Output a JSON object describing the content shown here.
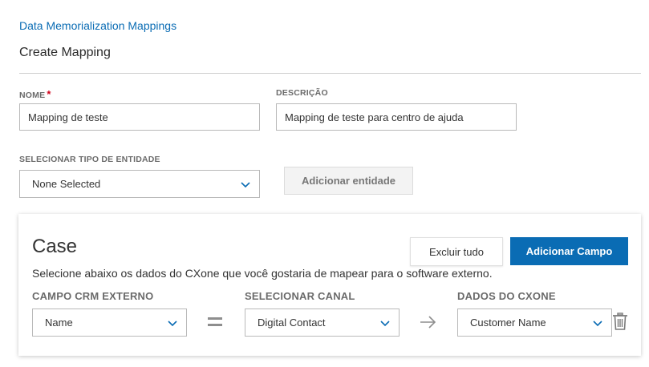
{
  "breadcrumb": {
    "label": "Data Memorialization Mappings"
  },
  "page": {
    "title": "Create Mapping"
  },
  "form": {
    "name_label": "NOME",
    "required_mark": "*",
    "name_value": "Mapping de teste",
    "description_label": "DESCRIÇÃO",
    "description_value": "Mapping de teste para centro de ajuda",
    "entity_type_label": "SELECIONAR TIPO DE ENTIDADE",
    "entity_type_value": "None Selected",
    "add_entity_label": "Adicionar entidade"
  },
  "card": {
    "title": "Case",
    "description": "Selecione abaixo os dados do CXone que você gostaria de mapear para o software externo.",
    "delete_all_label": "Excluir tudo",
    "add_field_label": "Adicionar Campo",
    "columns": {
      "external_crm_field": "CAMPO CRM EXTERNO",
      "select_channel": "SELECIONAR CANAL",
      "cxone_data": "DADOS DO CXONE"
    },
    "mapping_row": {
      "external_field": "Name",
      "channel": "Digital Contact",
      "cxone_field": "Customer Name"
    }
  },
  "colors": {
    "accent": "#0a6cb4",
    "required": "#d0021b"
  },
  "icons": {
    "dropdown": "chevron-down-icon",
    "equals": "equals-icon",
    "arrow": "arrow-right-icon",
    "delete": "trash-icon"
  }
}
